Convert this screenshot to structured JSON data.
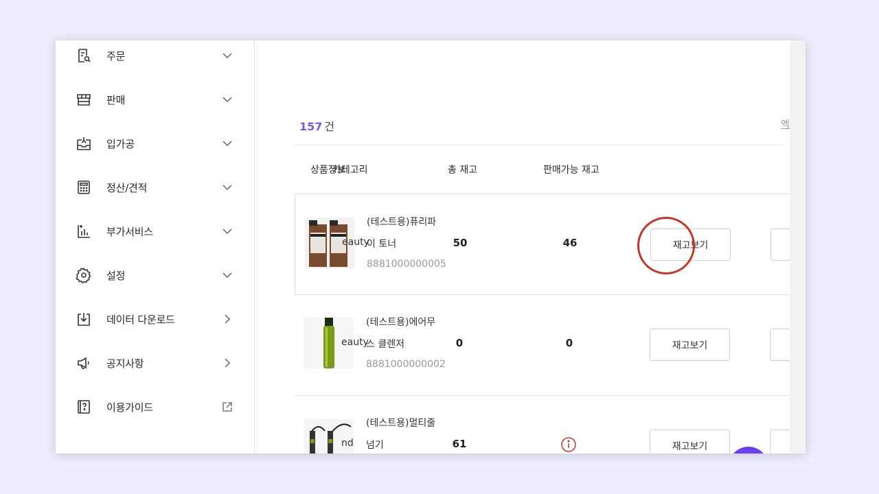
{
  "sidebar": {
    "items": [
      {
        "label": "주문",
        "icon": "order-search-icon",
        "chevron": "down"
      },
      {
        "label": "판매",
        "icon": "store-icon",
        "chevron": "down"
      },
      {
        "label": "입가공",
        "icon": "inbox-icon",
        "chevron": "down"
      },
      {
        "label": "정산/견적",
        "icon": "calculator-icon",
        "chevron": "down"
      },
      {
        "label": "부가서비스",
        "icon": "chart-plus-icon",
        "chevron": "down"
      },
      {
        "label": "설정",
        "icon": "gear-icon",
        "chevron": "down"
      },
      {
        "label": "데이터 다운로드",
        "icon": "download-icon",
        "chevron": "right"
      },
      {
        "label": "공지사항",
        "icon": "megaphone-icon",
        "chevron": "right"
      },
      {
        "label": "이용가이드",
        "icon": "guide-book-icon",
        "chevron": "external"
      }
    ]
  },
  "main": {
    "count_number": "157",
    "count_unit": "건",
    "excel_link": "엑",
    "headers": {
      "product_info": "상품정보",
      "category": "카테고리",
      "total_stock": "총 재고",
      "available_stock": "판매가능 재고"
    },
    "rows": [
      {
        "name_line1": "(테스트용)퓨리파",
        "category": "eauty",
        "name_line2": "이 토너",
        "code": "8881000000005",
        "total": "50",
        "available": "46",
        "button": "재고보기"
      },
      {
        "name_line1": "(테스트용)에어무",
        "category": "eauty",
        "name_line2": "스 클렌저",
        "code": "8881000000002",
        "total": "0",
        "available": "0",
        "button": "재고보기"
      },
      {
        "name_line1": "(테스트용)멀티줄",
        "category": "nd",
        "name_line2": "넘기",
        "code": "",
        "total": "61",
        "available": "",
        "button": "재고보기"
      }
    ]
  },
  "colors": {
    "accent": "#7b5bd6",
    "highlight_ring": "#c3372b",
    "fab": "#6a3ff0"
  }
}
